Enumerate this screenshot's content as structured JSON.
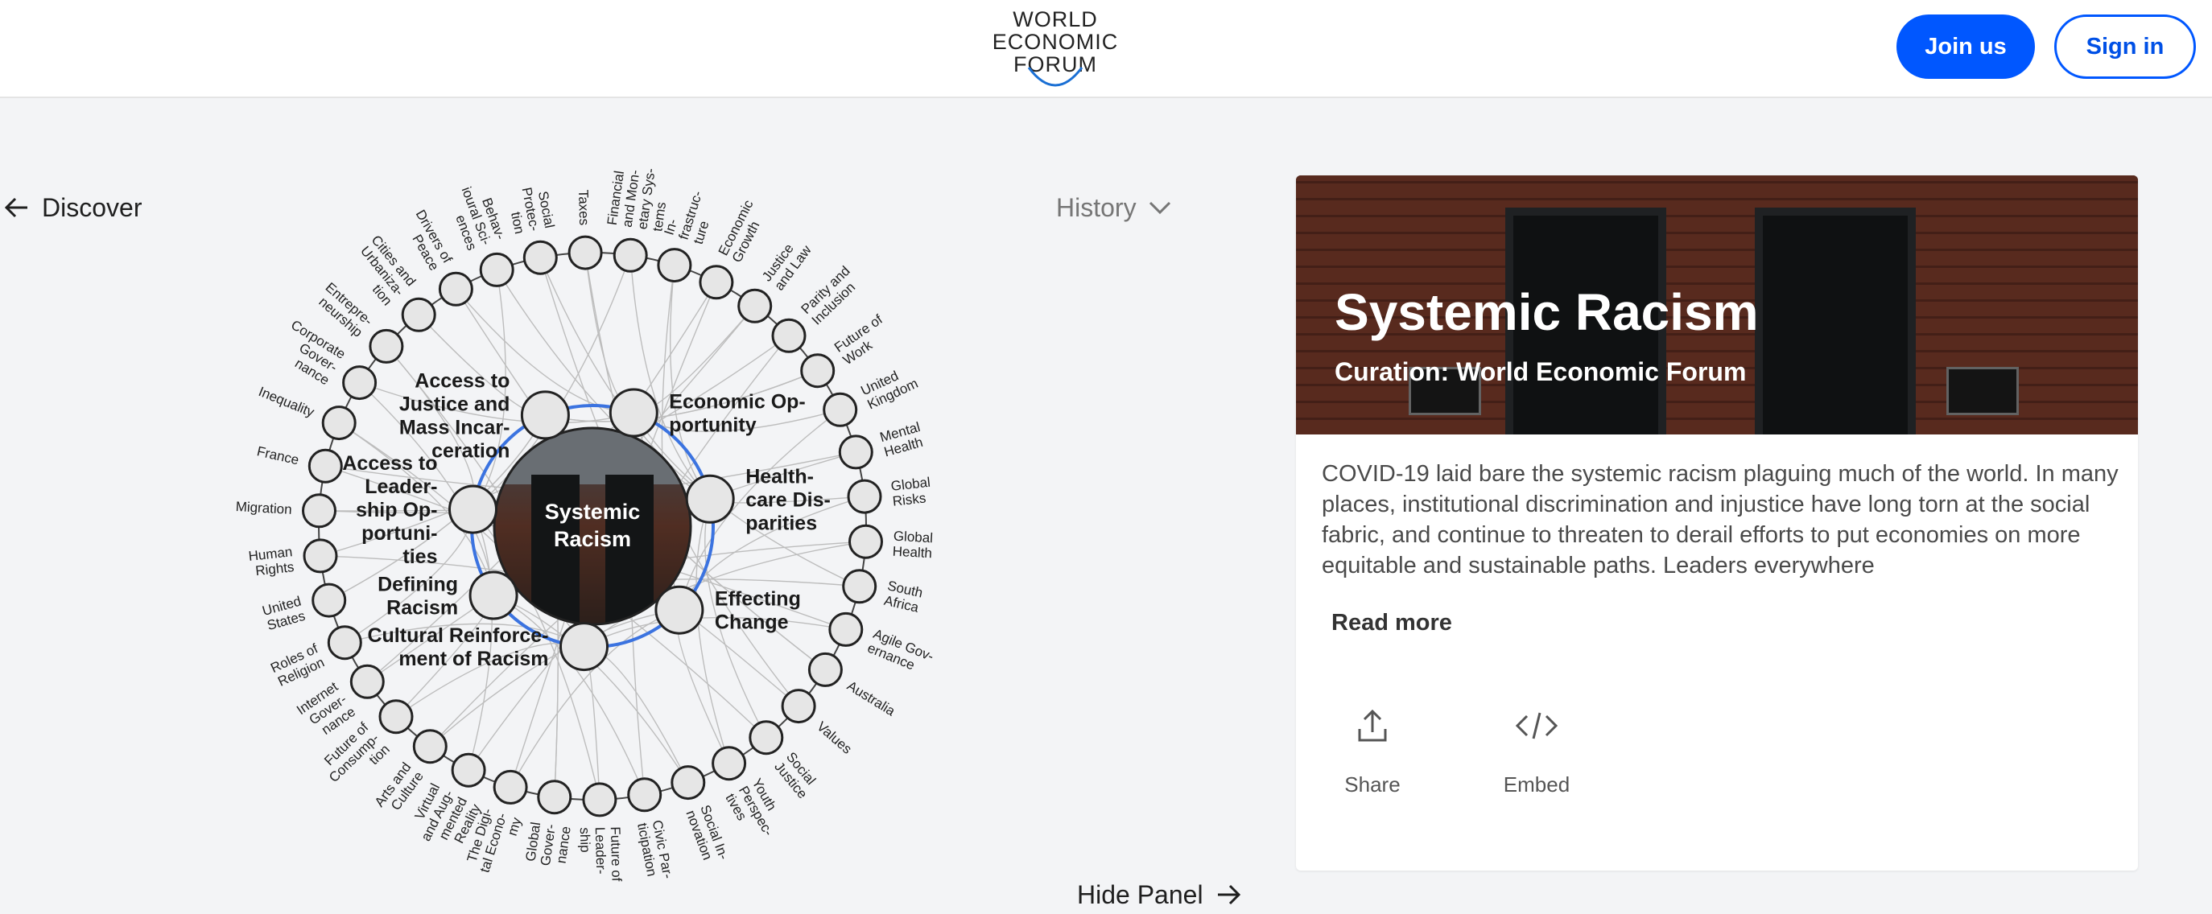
{
  "header": {
    "logo_lines": [
      "WORLD",
      "ECONOMIC",
      "FORUM"
    ],
    "join_label": "Join us",
    "signin_label": "Sign in"
  },
  "nav": {
    "discover_label": "Discover",
    "history_label": "History",
    "hide_panel_label": "Hide Panel"
  },
  "colors": {
    "accent": "#0057ff",
    "ring": "#3b73e0",
    "background": "#f3f4f6"
  },
  "graph": {
    "center": {
      "lines": [
        "Systemic",
        "Racism"
      ]
    },
    "inner_nodes": [
      {
        "lines": [
          "Economic Op-",
          "portunity"
        ]
      },
      {
        "lines": [
          "Health-",
          "care Dis-",
          "parities"
        ]
      },
      {
        "lines": [
          "Effecting",
          "Change"
        ]
      },
      {
        "lines": [
          "Cultural Reinforce-",
          "ment of Racism"
        ]
      },
      {
        "lines": [
          "Defining",
          "Racism"
        ]
      },
      {
        "lines": [
          "Access to",
          "Leader-",
          "ship Op-",
          "portuni-",
          "ties"
        ]
      },
      {
        "lines": [
          "Access to",
          "Justice and",
          "Mass Incar-",
          "ceration"
        ]
      }
    ],
    "outer_nodes": [
      {
        "lines": [
          "Taxes"
        ]
      },
      {
        "lines": [
          "Financial",
          "and Mon-",
          "etary Sys-",
          "tems"
        ]
      },
      {
        "lines": [
          "In-",
          "frastruc-",
          "ture"
        ]
      },
      {
        "lines": [
          "Economic",
          "Growth"
        ]
      },
      {
        "lines": [
          "Justice",
          "and Law"
        ]
      },
      {
        "lines": [
          "Parity and",
          "Inclusion"
        ]
      },
      {
        "lines": [
          "Future of",
          "Work"
        ]
      },
      {
        "lines": [
          "United",
          "Kingdom"
        ]
      },
      {
        "lines": [
          "Mental",
          "Health"
        ]
      },
      {
        "lines": [
          "Global",
          "Risks"
        ]
      },
      {
        "lines": [
          "Global",
          "Health"
        ]
      },
      {
        "lines": [
          "South",
          "Africa"
        ]
      },
      {
        "lines": [
          "Agile Gov-",
          "ernance"
        ]
      },
      {
        "lines": [
          "Australia"
        ]
      },
      {
        "lines": [
          "Values"
        ]
      },
      {
        "lines": [
          "Social",
          "Justice"
        ]
      },
      {
        "lines": [
          "Youth",
          "Perspec-",
          "tives"
        ]
      },
      {
        "lines": [
          "Social In-",
          "novation"
        ]
      },
      {
        "lines": [
          "Civic Par-",
          "ticipation"
        ]
      },
      {
        "lines": [
          "Future of",
          "Leader-",
          "ship"
        ]
      },
      {
        "lines": [
          "Global",
          "Gover-",
          "nance"
        ]
      },
      {
        "lines": [
          "The Digi-",
          "tal Econo-",
          "my"
        ]
      },
      {
        "lines": [
          "Virtual",
          "and Aug-",
          "mented",
          "Reality"
        ]
      },
      {
        "lines": [
          "Arts and",
          "Culture"
        ]
      },
      {
        "lines": [
          "Future of",
          "Consump-",
          "tion"
        ]
      },
      {
        "lines": [
          "Internet",
          "Gover-",
          "nance"
        ]
      },
      {
        "lines": [
          "Roles of",
          "Religion"
        ]
      },
      {
        "lines": [
          "United",
          "States"
        ]
      },
      {
        "lines": [
          "Human",
          "Rights"
        ]
      },
      {
        "lines": [
          "Migration"
        ]
      },
      {
        "lines": [
          "France"
        ]
      },
      {
        "lines": [
          "Inequality"
        ]
      },
      {
        "lines": [
          "Corporate",
          "Gover-",
          "nance"
        ]
      },
      {
        "lines": [
          "Entrepre-",
          "neurship"
        ]
      },
      {
        "lines": [
          "Cities and",
          "Urbaniza-",
          "tion"
        ]
      },
      {
        "lines": [
          "Drivers of",
          "Peace"
        ]
      },
      {
        "lines": [
          "Behav-",
          "ioural Sci-",
          "ences"
        ]
      },
      {
        "lines": [
          "Social",
          "Protec-",
          "tion"
        ]
      }
    ]
  },
  "panel": {
    "title": "Systemic Racism",
    "subtitle": "Curation: World Economic Forum",
    "description": "COVID-19 laid bare the systemic racism plaguing much of the world. In many places, institutional discrimination and injustice have long torn at the social fabric, and continue to threaten to derail efforts to put economies on more equitable and sustainable paths. Leaders everywhere",
    "read_more_label": "Read more",
    "actions": [
      {
        "label": "Share",
        "icon": "share-icon"
      },
      {
        "label": "Embed",
        "icon": "embed-icon"
      }
    ]
  }
}
